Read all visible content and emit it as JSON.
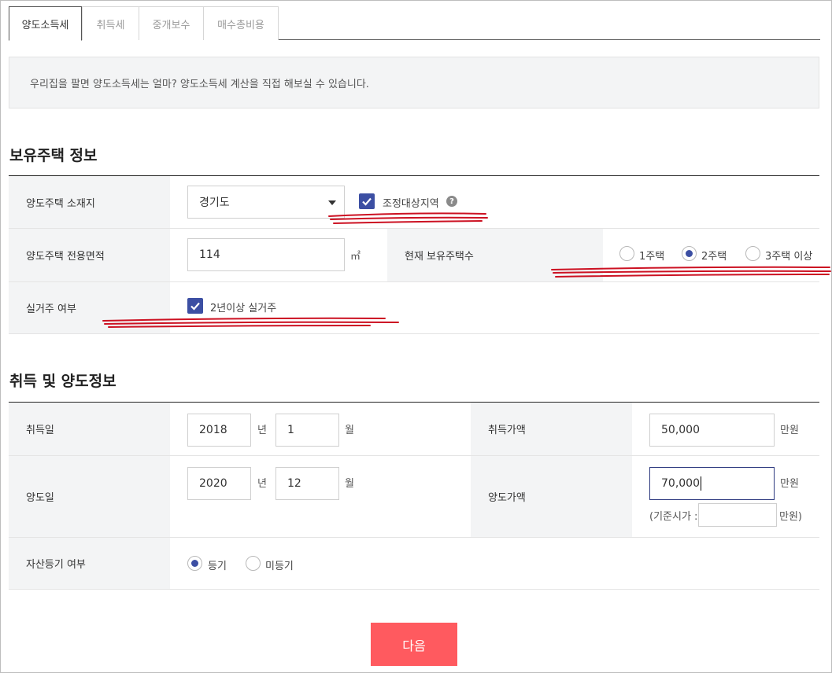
{
  "tabs": [
    "양도소득세",
    "취득세",
    "중개보수",
    "매수총비용"
  ],
  "info_text": "우리집을 팔면 양도소득세는 얼마? 양도소득세 계산을 직접 해보실 수 있습니다.",
  "section1": {
    "title": "보유주택 정보",
    "location_label": "양도주택 소재지",
    "location_value": "경기도",
    "adjust_area_label": "조정대상지역",
    "help_glyph": "?",
    "area_label": "양도주택 전용면적",
    "area_value": "114",
    "area_unit": "㎡",
    "house_count_label": "현재 보유주택수",
    "house_count_options": [
      "1주택",
      "2주택",
      "3주택 이상"
    ],
    "house_count_selected": "2주택",
    "residence_label": "실거주 여부",
    "residence_check_label": "2년이상 실거주"
  },
  "section2": {
    "title": "취득 및 양도정보",
    "acq_date_label": "취득일",
    "acq_year": "2018",
    "acq_month": "1",
    "year_unit": "년",
    "month_unit": "월",
    "acq_price_label": "취득가액",
    "acq_price": "50,000",
    "price_unit": "만원",
    "sale_date_label": "양도일",
    "sale_year": "2020",
    "sale_month": "12",
    "sale_price_label": "양도가액",
    "sale_price": "70,000",
    "base_price_prefix": "(기준시가 :",
    "base_price_suffix": "만원)",
    "registration_label": "자산등기 여부",
    "registration_options": [
      "등기",
      "미등기"
    ],
    "registration_selected": "등기"
  },
  "next_button": "다음",
  "colors": {
    "accent": "#3c4fa3",
    "button": "#ff5a5f",
    "scribble": "#cc1122"
  }
}
